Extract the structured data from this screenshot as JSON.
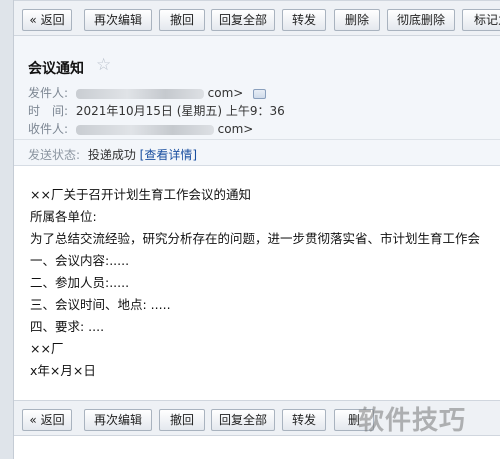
{
  "toolbar": {
    "back": "« 返回",
    "edit_again": "再次编辑",
    "recall": "撤回",
    "reply_all": "回复全部",
    "forward": "转发",
    "delete": "删除",
    "delete_permanently": "彻底删除",
    "mark_as": "标记为"
  },
  "email": {
    "subject": "会议通知",
    "sender_label": "发件人:",
    "sender_suffix": "com>",
    "time_label": "时　间:",
    "time_value": "2021年10月15日 (星期五) 上午9：36",
    "recipient_label": "收件人:",
    "recipient_suffix": "com>",
    "status_label": "发送状态:",
    "status_value": "投递成功",
    "status_link": "[查看详情]"
  },
  "body": {
    "lines": [
      "××厂关于召开计划生育工作会议的通知",
      "所属各单位:",
      "为了总结交流经验，研究分析存在的问题，进一步贯彻落实省、市计划生育工作会",
      "一、会议内容:.....",
      "二、参加人员:.....",
      "三、会议时间、地点: .....",
      "四、要求: ....",
      "××厂",
      "x年×月×日"
    ]
  },
  "bottom_toolbar": {
    "back": "« 返回",
    "edit_again": "再次编辑",
    "recall": "撤回",
    "reply_all": "回复全部",
    "forward": "转发",
    "delete_partial": "删"
  },
  "watermark": "软件技巧"
}
